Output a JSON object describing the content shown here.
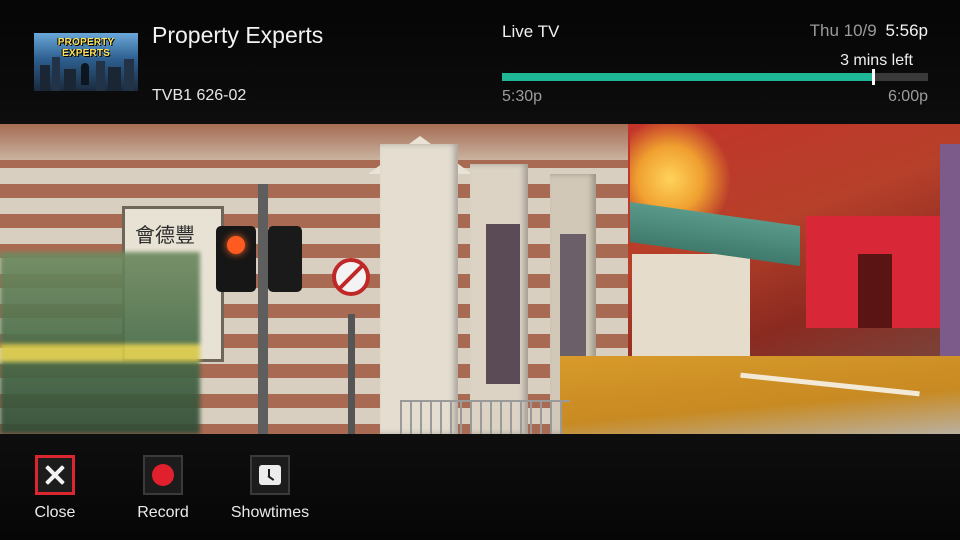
{
  "program": {
    "thumbnail_text": "PROPERTY EXPERTS",
    "title": "Property Experts",
    "channel": "TVB1 626-02"
  },
  "status": {
    "mode_label": "Live TV",
    "date": "Thu 10/9",
    "time": "5:56p",
    "remaining": "3 mins left",
    "start_time": "5:30p",
    "end_time": "6:00p",
    "progress_fraction": 0.87
  },
  "actions": [
    {
      "label": "Close",
      "icon": "close-icon",
      "selected": true
    },
    {
      "label": "Record",
      "icon": "record-icon",
      "selected": false
    },
    {
      "label": "Showtimes",
      "icon": "clock-icon",
      "selected": false
    }
  ],
  "colors": {
    "progress": "#1fb896",
    "selection": "#d9262f",
    "record": "#e0202c"
  },
  "video": {
    "sign_text": "會德豐"
  }
}
